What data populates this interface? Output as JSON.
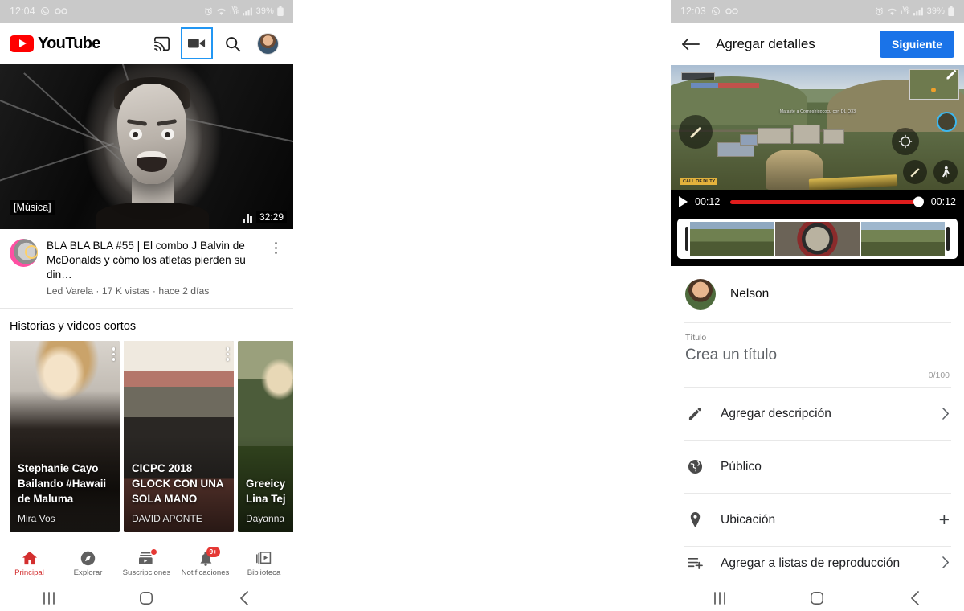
{
  "left_phone": {
    "status_bar": {
      "time": "12:04",
      "icons": [
        "whatsapp-icon",
        "voicemail-icon"
      ],
      "right_icons": [
        "alarm-icon",
        "wifi-icon",
        "volte-icon",
        "signal-icon"
      ],
      "volte_label": "VoLTE",
      "battery": "39%"
    },
    "topbar": {
      "logo_text": "YouTube",
      "actions": [
        "cast-icon",
        "camera-icon",
        "search-icon",
        "account-avatar"
      ],
      "highlighted_action": "camera-icon",
      "highlight_color": "#2196f3"
    },
    "feed_video": {
      "caption_tag": "[Música]",
      "duration": "32:29",
      "title": "BLA BLA BLA #55 | El combo J Balvin de McDonalds y cómo los atletas pierden su din…",
      "meta": "Led Varela · 17 K vistas · hace 2 días",
      "channel": "Led Varela",
      "views": "17 K vistas",
      "published": "hace 2 días"
    },
    "stories": {
      "section_title": "Historias y videos cortos",
      "cards": [
        {
          "title": "Stephanie Cayo Bailando #Hawaii de Maluma",
          "author": "Mira Vos"
        },
        {
          "title": "CICPC 2018 GLOCK CON UNA SOLA MANO",
          "author": "DAVID APONTE"
        },
        {
          "title": "Greeicy Lina Tej",
          "author": "Dayanna"
        }
      ]
    },
    "bottom_nav": [
      {
        "label": "Principal",
        "icon": "home-icon",
        "active": true,
        "badge": ""
      },
      {
        "label": "Explorar",
        "icon": "compass-icon",
        "active": false,
        "badge": ""
      },
      {
        "label": "Suscripciones",
        "icon": "subscriptions-icon",
        "active": false,
        "badge": "dot"
      },
      {
        "label": "Notificaciones",
        "icon": "bell-icon",
        "active": false,
        "badge": "9+"
      },
      {
        "label": "Biblioteca",
        "icon": "library-icon",
        "active": false,
        "badge": ""
      }
    ],
    "android_nav": [
      "recents-icon",
      "home-icon",
      "back-icon"
    ]
  },
  "right_phone": {
    "status_bar": {
      "time": "12:03",
      "icons": [
        "whatsapp-icon",
        "voicemail-icon"
      ],
      "right_icons": [
        "alarm-icon",
        "wifi-icon",
        "volte-icon",
        "signal-icon"
      ],
      "volte_label": "VoLTE",
      "battery": "39%"
    },
    "appbar": {
      "back_icon": "arrow-back-icon",
      "title": "Agregar detalles",
      "next_button": "Siguiente",
      "next_button_color": "#1a73e8"
    },
    "preview": {
      "game_label": "CALL OF DUTY",
      "hud_message": "Mataste a Cornoshigococu con DL Q33",
      "current_time": "00:12",
      "total_time": "00:12",
      "edit_icon": "pencil-icon",
      "play_icon": "play-icon"
    },
    "account": {
      "name": "Nelson",
      "avatar": "account-avatar"
    },
    "title_field": {
      "label": "Título",
      "placeholder": "Crea un título",
      "counter": "0/100"
    },
    "rows": [
      {
        "label": "Agregar descripción",
        "icon": "pencil-icon",
        "trailing": "chevron-right-icon"
      },
      {
        "label": "Público",
        "icon": "globe-icon",
        "trailing": ""
      },
      {
        "label": "Ubicación",
        "icon": "location-pin-icon",
        "trailing": "plus-icon"
      },
      {
        "label": "Agregar a listas de reproducción",
        "icon": "playlist-add-icon",
        "trailing": "chevron-right-icon"
      }
    ],
    "android_nav": [
      "recents-icon",
      "home-icon",
      "back-icon"
    ]
  }
}
